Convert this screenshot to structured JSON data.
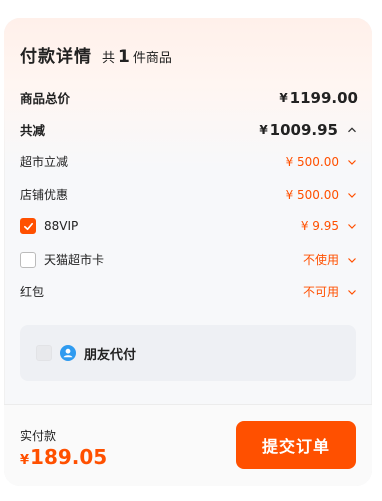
{
  "header": {
    "title": "付款详情",
    "count_prefix": "共",
    "count_value": "1",
    "count_suffix": "件商品"
  },
  "rows": {
    "total": {
      "label": "商品总价",
      "currency": "¥",
      "amount": "1199.00"
    },
    "discount_total": {
      "label": "共减",
      "currency": "¥",
      "amount": "1009.95"
    },
    "supermarket": {
      "label": "超市立减",
      "value": "¥ 500.00"
    },
    "store": {
      "label": "店铺优惠",
      "value": "¥ 500.00"
    },
    "vip": {
      "label": "88VIP",
      "value": "¥ 9.95",
      "checked": true
    },
    "tmall_card": {
      "label": "天猫超市卡",
      "value": "不使用",
      "checked": false
    },
    "red_packet": {
      "label": "红包",
      "value": "不可用"
    }
  },
  "friend_pay": {
    "label": "朋友代付"
  },
  "footer": {
    "paid_label": "实付款",
    "currency": "¥",
    "paid_amount": "189.05",
    "submit_label": "提交订单"
  },
  "colors": {
    "accent": "#ff5000",
    "panel_bg": "#f7f8fa"
  },
  "icons": [
    "chevron-down-icon",
    "chevron-up-icon",
    "check-icon",
    "friend-pay-icon"
  ]
}
